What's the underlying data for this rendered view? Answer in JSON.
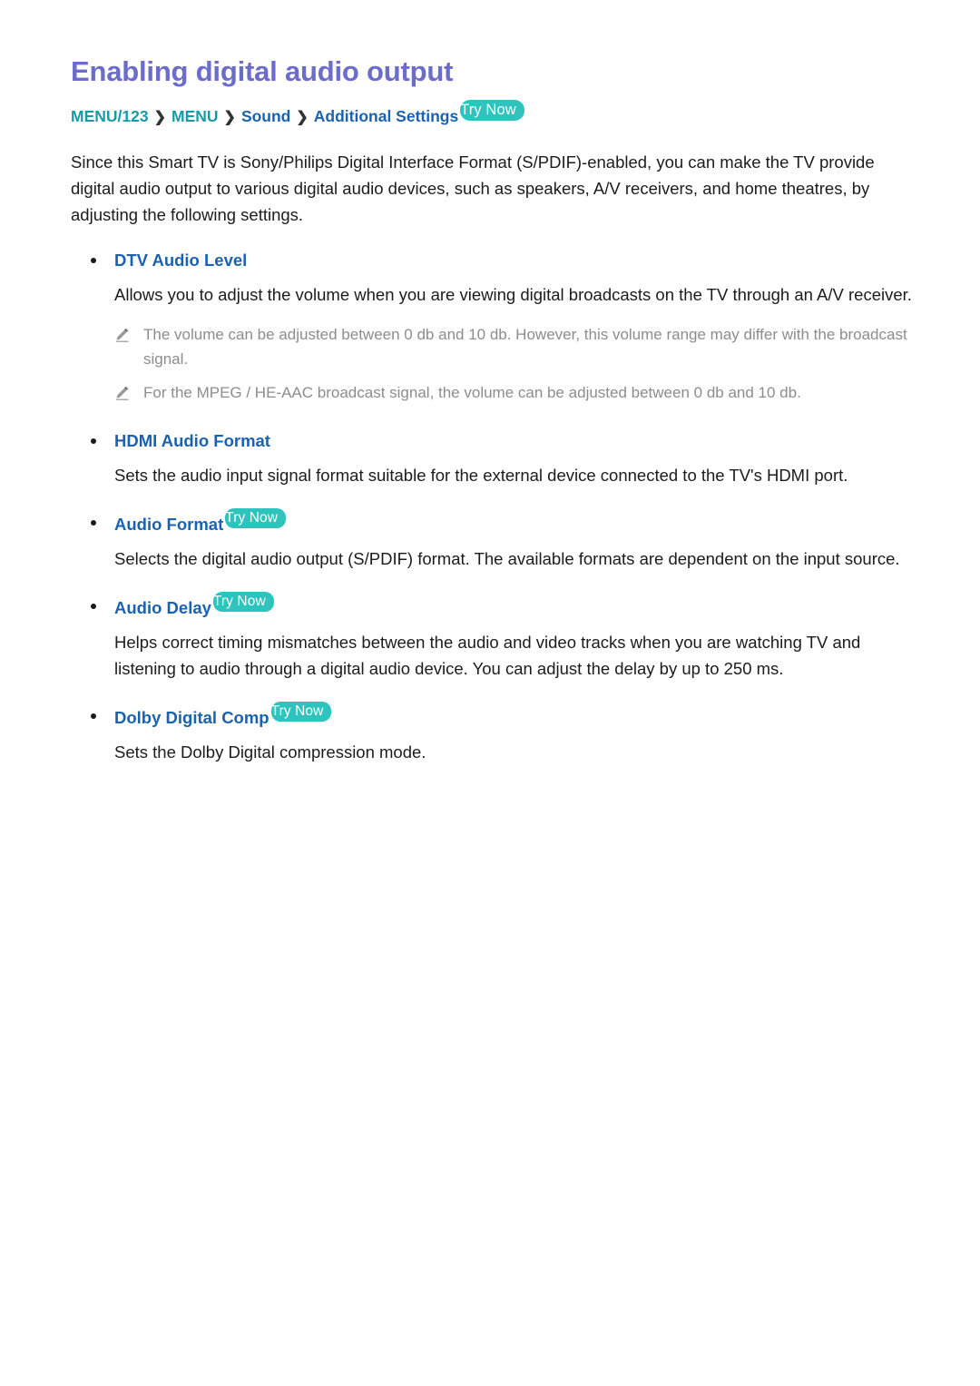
{
  "document": {
    "title": "Enabling digital audio output",
    "breadcrumb": {
      "items": [
        {
          "label": "MENU/123",
          "color": "teal"
        },
        {
          "label": "MENU",
          "color": "teal"
        },
        {
          "label": "Sound",
          "color": "blue"
        },
        {
          "label": "Additional Settings",
          "color": "blue"
        }
      ],
      "separator": "❯",
      "try_now": "Try Now"
    },
    "intro": "Since this Smart TV is Sony/Philips Digital Interface Format (S/PDIF)-enabled, you can make the TV provide digital audio output to various digital audio devices, such as speakers, A/V receivers, and home theatres, by adjusting the following settings.",
    "sections": [
      {
        "heading": "DTV Audio Level",
        "try_now": null,
        "body": "Allows you to adjust the volume when you are viewing digital broadcasts on the TV through an A/V receiver.",
        "notes": [
          "The volume can be adjusted between 0 db and 10 db. However, this volume range may differ with the broadcast signal.",
          "For the MPEG / HE-AAC broadcast signal, the volume can be adjusted between 0 db and 10 db."
        ]
      },
      {
        "heading": "HDMI Audio Format",
        "try_now": null,
        "body": "Sets the audio input signal format suitable for the external device connected to the TV's HDMI port.",
        "notes": []
      },
      {
        "heading": "Audio Format",
        "try_now": "Try Now",
        "body": "Selects the digital audio output (S/PDIF) format. The available formats are dependent on the input source.",
        "notes": []
      },
      {
        "heading": "Audio Delay",
        "try_now": "Try Now",
        "body": "Helps correct timing mismatches between the audio and video tracks when you are watching TV and listening to audio through a digital audio device. You can adjust the delay by up to 250 ms.",
        "notes": []
      },
      {
        "heading": "Dolby Digital Comp",
        "try_now": "Try Now",
        "body": "Sets the Dolby Digital compression mode.",
        "notes": []
      }
    ],
    "icons": {
      "note_icon": "pencil-icon",
      "bullet": "bullet-dot"
    },
    "colors": {
      "title": "#6b6ccb",
      "heading_blue": "#1a62b0",
      "crumb_teal": "#179aa8",
      "try_now_bg": "#2ec3bd",
      "note_gray": "#8d8d8d",
      "body": "#1c1c1c"
    }
  }
}
